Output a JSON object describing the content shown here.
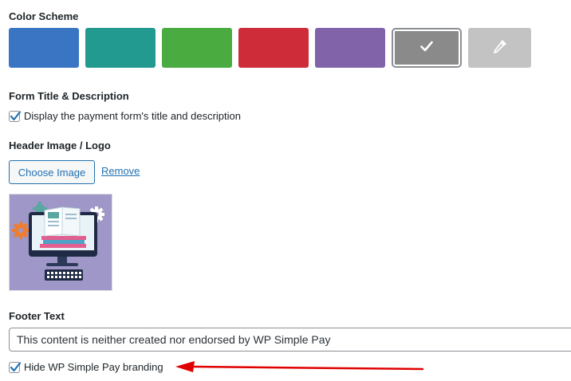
{
  "color_scheme": {
    "title": "Color Scheme",
    "swatches": [
      {
        "name": "blue",
        "color": "#3a75c4"
      },
      {
        "name": "teal",
        "color": "#229a90"
      },
      {
        "name": "green",
        "color": "#4aab41"
      },
      {
        "name": "red",
        "color": "#cd2c38"
      },
      {
        "name": "purple",
        "color": "#8163aa"
      },
      {
        "name": "gray",
        "color": "#8a8a8a",
        "selected": true,
        "icon": "checkmark-icon"
      },
      {
        "name": "custom",
        "color": "#c3c3c3",
        "icon": "eyedropper-icon"
      }
    ]
  },
  "form_title": {
    "title": "Form Title & Description",
    "checkbox_label": "Display the payment form's title and description",
    "checked": true
  },
  "header_image": {
    "title": "Header Image / Logo",
    "choose_label": "Choose Image",
    "remove_label": "Remove",
    "preview_icon": "computer-illustration-icon"
  },
  "footer": {
    "title": "Footer Text",
    "value": "This content is neither created nor endorsed by WP Simple Pay",
    "branding_label": "Hide WP Simple Pay branding",
    "branding_checked": true
  },
  "colors": {
    "accent": "#2271b1",
    "annotation_arrow": "#e00000"
  }
}
